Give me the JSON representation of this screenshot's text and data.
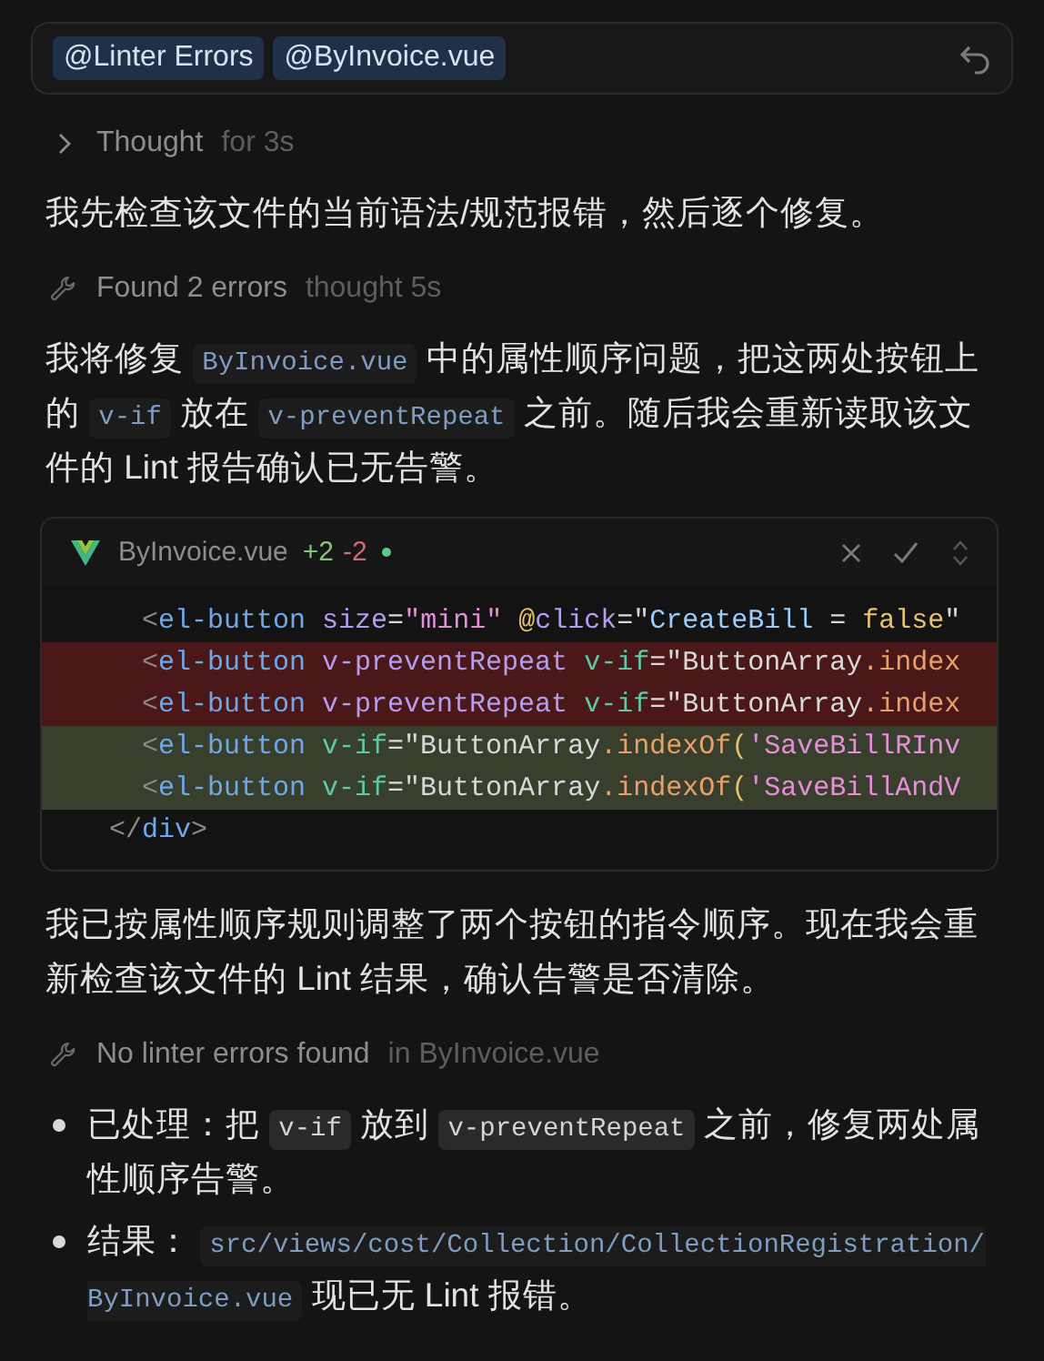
{
  "context_chips": [
    {
      "label": "@Linter Errors"
    },
    {
      "label": "@ByInvoice.vue"
    }
  ],
  "feed": [
    {
      "kind": "status",
      "expandable": true,
      "label": "Thought",
      "detail": "for 3s"
    },
    {
      "kind": "paragraph",
      "segments": [
        {
          "kind": "text",
          "text": "我先检查该文件的当前语法/规范报错，然后逐个修复。"
        }
      ]
    },
    {
      "kind": "status",
      "expandable": false,
      "label": "Found 2 errors",
      "detail": "thought 5s"
    },
    {
      "kind": "paragraph",
      "segments": [
        {
          "kind": "text",
          "text": "我将修复 "
        },
        {
          "kind": "ref",
          "text": "ByInvoice.vue"
        },
        {
          "kind": "text",
          "text": " 中的属性顺序问题，把这两处按钮上的 "
        },
        {
          "kind": "ref",
          "text": "v-if"
        },
        {
          "kind": "text",
          "text": " 放在 "
        },
        {
          "kind": "ref",
          "text": "v-preventRepeat"
        },
        {
          "kind": "text",
          "text": " 之前。随后我会重新读取该文件的 Lint 报告确认已无告警。"
        }
      ]
    },
    {
      "kind": "diff",
      "file": "ByInvoice.vue",
      "added": "+2",
      "removed": "-2",
      "modified": true,
      "lines": [
        {
          "added": false,
          "removed": false,
          "tokens": [
            {
              "text": "    <",
              "kind": "punct"
            },
            {
              "text": "el-button",
              "kind": "tag"
            },
            {
              "text": " size",
              "kind": "attr"
            },
            {
              "text": "=",
              "kind": "op"
            },
            {
              "text": "\"mini\"",
              "kind": "string"
            },
            {
              "text": " @",
              "kind": "keyword"
            },
            {
              "text": "click",
              "kind": "attr"
            },
            {
              "text": "=\"",
              "kind": "op"
            },
            {
              "text": "CreateBill",
              "kind": "ident"
            },
            {
              "text": " = ",
              "kind": "op"
            },
            {
              "text": "false",
              "kind": "keyword"
            },
            {
              "text": "\"",
              "kind": "op"
            }
          ]
        },
        {
          "added": false,
          "removed": true,
          "tokens": [
            {
              "text": "    <",
              "kind": "punct"
            },
            {
              "text": "el-button",
              "kind": "tag"
            },
            {
              "text": " v-preventRepeat",
              "kind": "attr"
            },
            {
              "text": " v-if",
              "kind": "directive"
            },
            {
              "text": "=\"ButtonArray",
              "kind": "op"
            },
            {
              "text": ".index",
              "kind": "method"
            }
          ]
        },
        {
          "added": false,
          "removed": true,
          "tokens": [
            {
              "text": "    <",
              "kind": "punct"
            },
            {
              "text": "el-button",
              "kind": "tag"
            },
            {
              "text": " v-preventRepeat",
              "kind": "attr"
            },
            {
              "text": " v-if",
              "kind": "directive"
            },
            {
              "text": "=\"ButtonArray",
              "kind": "op"
            },
            {
              "text": ".index",
              "kind": "method"
            }
          ]
        },
        {
          "added": true,
          "removed": false,
          "tokens": [
            {
              "text": "    <",
              "kind": "punct"
            },
            {
              "text": "el-button",
              "kind": "tag"
            },
            {
              "text": " v-if",
              "kind": "directive"
            },
            {
              "text": "=\"ButtonArray",
              "kind": "op"
            },
            {
              "text": ".indexOf",
              "kind": "method"
            },
            {
              "text": "(",
              "kind": "keyword"
            },
            {
              "text": "'SaveBillRInv",
              "kind": "string"
            }
          ]
        },
        {
          "added": true,
          "removed": false,
          "tokens": [
            {
              "text": "    <",
              "kind": "punct"
            },
            {
              "text": "el-button",
              "kind": "tag"
            },
            {
              "text": " v-if",
              "kind": "directive"
            },
            {
              "text": "=\"ButtonArray",
              "kind": "op"
            },
            {
              "text": ".indexOf",
              "kind": "method"
            },
            {
              "text": "(",
              "kind": "keyword"
            },
            {
              "text": "'SaveBillAndV",
              "kind": "string"
            }
          ]
        },
        {
          "added": false,
          "removed": false,
          "tokens": [
            {
              "text": "  </",
              "kind": "punct"
            },
            {
              "text": "div",
              "kind": "tag"
            },
            {
              "text": ">",
              "kind": "punct"
            }
          ]
        }
      ]
    },
    {
      "kind": "paragraph",
      "segments": [
        {
          "kind": "text",
          "text": "我已按属性顺序规则调整了两个按钮的指令顺序。现在我会重新检查该文件的 Lint 结果，确认告警是否清除。"
        }
      ]
    },
    {
      "kind": "status",
      "expandable": false,
      "label": "No linter errors found",
      "detail": "in ByInvoice.vue"
    },
    {
      "kind": "bullets",
      "items": [
        {
          "segments": [
            {
              "kind": "text",
              "text": "已处理：把 "
            },
            {
              "kind": "code",
              "text": "v-if"
            },
            {
              "kind": "text",
              "text": " 放到 "
            },
            {
              "kind": "code",
              "text": "v-preventRepeat"
            },
            {
              "kind": "text",
              "text": " 之前，修复两处属性顺序告警。"
            }
          ]
        },
        {
          "segments": [
            {
              "kind": "text",
              "text": "结果： "
            },
            {
              "kind": "ref",
              "text": "src/views/cost/Collection/CollectionRegistration/ByInvoice.vue"
            },
            {
              "kind": "text",
              "text": " 现已无 Lint 报错。"
            }
          ]
        }
      ]
    }
  ]
}
